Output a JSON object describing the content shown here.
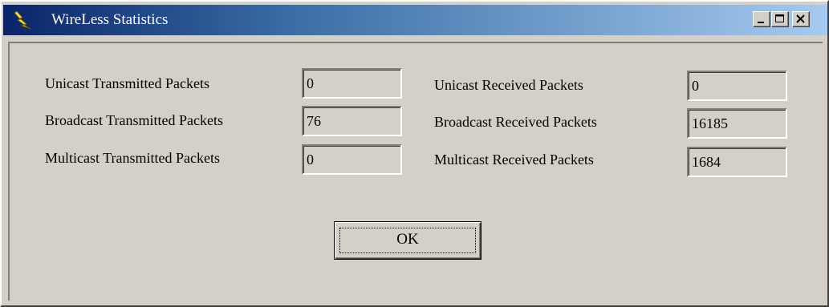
{
  "window": {
    "title": "WireLess Statistics",
    "icon": "lightning-bolt-icon"
  },
  "caption_buttons": [
    "minimize-icon",
    "maximize-icon",
    "close-icon"
  ],
  "stats": {
    "unicast_tx": {
      "label": "Unicast Transmitted Packets",
      "value": "0"
    },
    "broadcast_tx": {
      "label": "Broadcast Transmitted Packets",
      "value": "76"
    },
    "multicast_tx": {
      "label": "Multicast Transmitted Packets",
      "value": "0"
    },
    "unicast_rx": {
      "label": "Unicast Received Packets",
      "value": "0"
    },
    "broadcast_rx": {
      "label": "Broadcast Received Packets",
      "value": "16185"
    },
    "multicast_rx": {
      "label": "Multicast Received Packets",
      "value": "1684"
    }
  },
  "ok_button": {
    "label": "OK"
  },
  "colors": {
    "title_start": "#0a246a",
    "title_end": "#a6caf0",
    "face": "#d4d0c8"
  }
}
